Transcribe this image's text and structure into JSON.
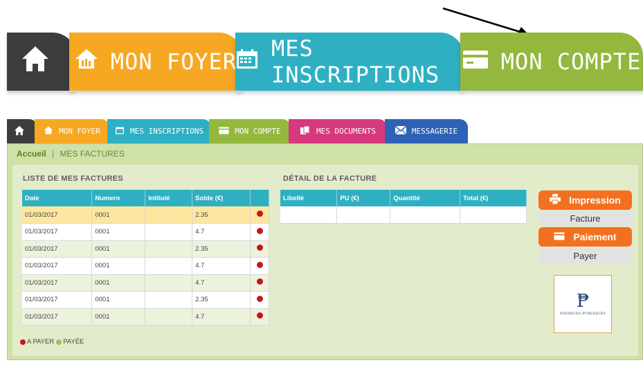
{
  "zoom_nav": {
    "home_label": "",
    "foyer_label": "MON FOYER",
    "inscriptions_label": "MES INSCRIPTIONS",
    "compte_label": "MON COMPTE"
  },
  "nav": {
    "home_label": "",
    "tabs": [
      {
        "label": "MON FOYER",
        "color": "#f7a823"
      },
      {
        "label": "MES INSCRIPTIONS",
        "color": "#2fb0c2"
      },
      {
        "label": "MON COMPTE",
        "color": "#94b83e"
      },
      {
        "label": "MES DOCUMENTS",
        "color": "#d6397d"
      },
      {
        "label": "MESSAGERIE",
        "color": "#2e62b6"
      }
    ]
  },
  "breadcrumb": {
    "home": "Accueil",
    "separator": "|",
    "current": "MES FACTURES"
  },
  "invoices": {
    "title": "LISTE DE MES FACTURES",
    "columns": [
      "Date",
      "Numero",
      "Intitulé",
      "Solde (€)",
      ""
    ],
    "rows": [
      {
        "date": "01/03/2017",
        "numero": "0001",
        "intitule": "",
        "solde": "2.35",
        "status": "A PAYER"
      },
      {
        "date": "01/03/2017",
        "numero": "0001",
        "intitule": "",
        "solde": "4.7",
        "status": "A PAYER"
      },
      {
        "date": "01/03/2017",
        "numero": "0001",
        "intitule": "",
        "solde": "2.35",
        "status": "A PAYER"
      },
      {
        "date": "01/03/2017",
        "numero": "0001",
        "intitule": "",
        "solde": "4.7",
        "status": "A PAYER"
      },
      {
        "date": "01/03/2017",
        "numero": "0001",
        "intitule": "",
        "solde": "4.7",
        "status": "A PAYER"
      },
      {
        "date": "01/03/2017",
        "numero": "0001",
        "intitule": "",
        "solde": "2.35",
        "status": "A PAYER"
      },
      {
        "date": "01/03/2017",
        "numero": "0001",
        "intitule": "",
        "solde": "4.7",
        "status": "A PAYER"
      }
    ],
    "selected_index": 0
  },
  "detail": {
    "title": "DÉTAIL DE LA FACTURE",
    "columns": [
      "Libellé",
      "PU (€)",
      "Quantité",
      "Total (€)"
    ]
  },
  "actions": {
    "impression_label": "Impression",
    "facture_label": "Facture",
    "paiement_label": "Paiement",
    "payer_label": "Payer"
  },
  "legend": {
    "unpaid": "A PAYER",
    "paid": "PAYÉE"
  },
  "logo": {
    "text": "FINANCES PUBLIQUES"
  },
  "colors": {
    "accent_orange": "#f37021",
    "teal": "#2fb0c2",
    "green": "#94b83e",
    "unpaid": "#c4161c",
    "paid": "#9cc25a"
  }
}
